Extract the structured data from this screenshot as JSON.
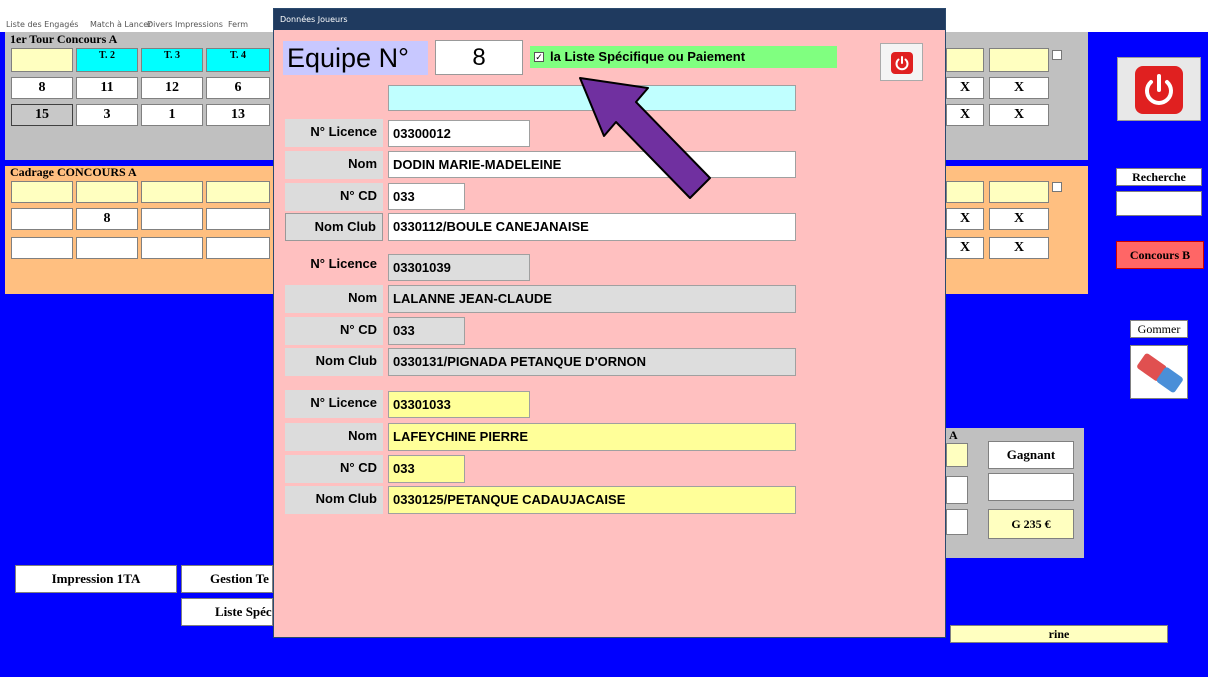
{
  "menu": {
    "items": [
      "Liste des Engagés",
      "Match à Lancer",
      "Divers",
      "Impressions",
      "Ferm"
    ]
  },
  "panel1": {
    "title": "1er Tour Concours A",
    "headers": [
      "",
      "T. 2",
      "T. 3",
      "T. 4"
    ],
    "row1": [
      "8",
      "11",
      "12",
      "6"
    ],
    "row2": [
      "15",
      "3",
      "1",
      "13"
    ],
    "right_row1": [
      "X",
      "X"
    ],
    "right_row2": [
      "X",
      "X"
    ]
  },
  "panel2": {
    "title": "Cadrage CONCOURS A",
    "row1": [
      "",
      "8",
      "",
      ""
    ],
    "row2": [
      "",
      "",
      "",
      ""
    ],
    "right_row1": [
      "X",
      "X"
    ],
    "right_row2": [
      "X",
      "X"
    ]
  },
  "right_panel": {
    "recherche": "Recherche",
    "concours_b": "Concours B",
    "gommer": "Gommer"
  },
  "bottom_right": {
    "letter": "A",
    "gagnant": "Gagnant",
    "prize": "G 235 €",
    "banner": "rine"
  },
  "bottom_left": {
    "impression": "Impression 1TA",
    "gestion": "Gestion Te",
    "liste": "Liste Spéc"
  },
  "dialog": {
    "title": "Données Joueurs",
    "equipe_label": "Equipe N°",
    "equipe_value": "8",
    "checkbox_label": "la Liste Spécifique ou Paiement",
    "checkbox_checked": true,
    "player1": {
      "licence_label": "N° Licence",
      "licence": "03300012",
      "nom_label": "Nom",
      "nom": "DODIN MARIE-MADELEINE",
      "cd_label": "N° CD",
      "cd": "033",
      "club_label": "Nom Club",
      "club": "0330112/BOULE CANEJANAISE"
    },
    "player2": {
      "licence_label": "N° Licence",
      "licence": "03301039",
      "nom_label": "Nom",
      "nom": "LALANNE JEAN-CLAUDE",
      "cd_label": "N° CD",
      "cd": "033",
      "club_label": "Nom Club",
      "club": "0330131/PIGNADA PETANQUE D'ORNON"
    },
    "player3": {
      "licence_label": "N° Licence",
      "licence": "03301033",
      "nom_label": "Nom",
      "nom": "LAFEYCHINE PIERRE",
      "cd_label": "N° CD",
      "cd": "033",
      "club_label": "Nom Club",
      "club": "0330125/PETANQUE CADAUJACAISE"
    }
  },
  "colors": {
    "background": "#0000ff",
    "dialog": "#ffc0c0",
    "arrow": "#7030a0",
    "power_button": "#e02020"
  }
}
